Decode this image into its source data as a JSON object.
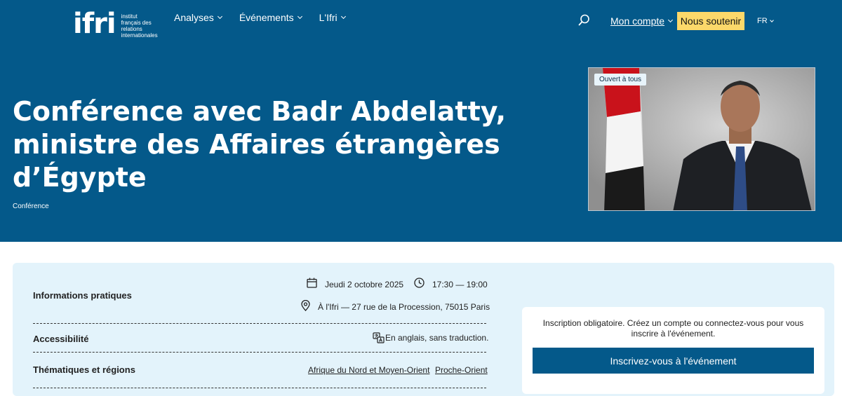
{
  "header": {
    "logo": {
      "mark": "ifri",
      "lines": [
        "institut",
        "français des",
        "relations",
        "internationales"
      ]
    },
    "nav": [
      {
        "label": "Analyses"
      },
      {
        "label": "Événements"
      },
      {
        "label": "L'Ifri"
      }
    ],
    "account_label": "Mon compte",
    "support_label": "Nous soutenir",
    "language": "FR"
  },
  "hero": {
    "title": "Conférence avec Badr Abdelatty, ministre des Affaires étrangères d’Égypte",
    "category": "Conférence",
    "badge": "Ouvert à tous"
  },
  "practical": {
    "label": "Informations pratiques",
    "date": "Jeudi 2 octobre 2025",
    "time": "17:30 — 19:00",
    "location": "À l'Ifri — 27 rue de la Procession, 75015 Paris"
  },
  "accessibility": {
    "label": "Accessibilité",
    "value": "En anglais, sans traduction."
  },
  "topics": {
    "label": "Thématiques et régions",
    "tags": [
      "Afrique du Nord et Moyen-Orient",
      "Proche-Orient"
    ]
  },
  "registration": {
    "text": "Inscription obligatoire. Créez un compte ou connectez-vous pour vous inscrire à l'événement.",
    "button": "Inscrivez-vous à l'événement"
  },
  "colors": {
    "primary": "#04598a",
    "accent": "#fcd86a",
    "info_bg": "#e3f3fb"
  }
}
